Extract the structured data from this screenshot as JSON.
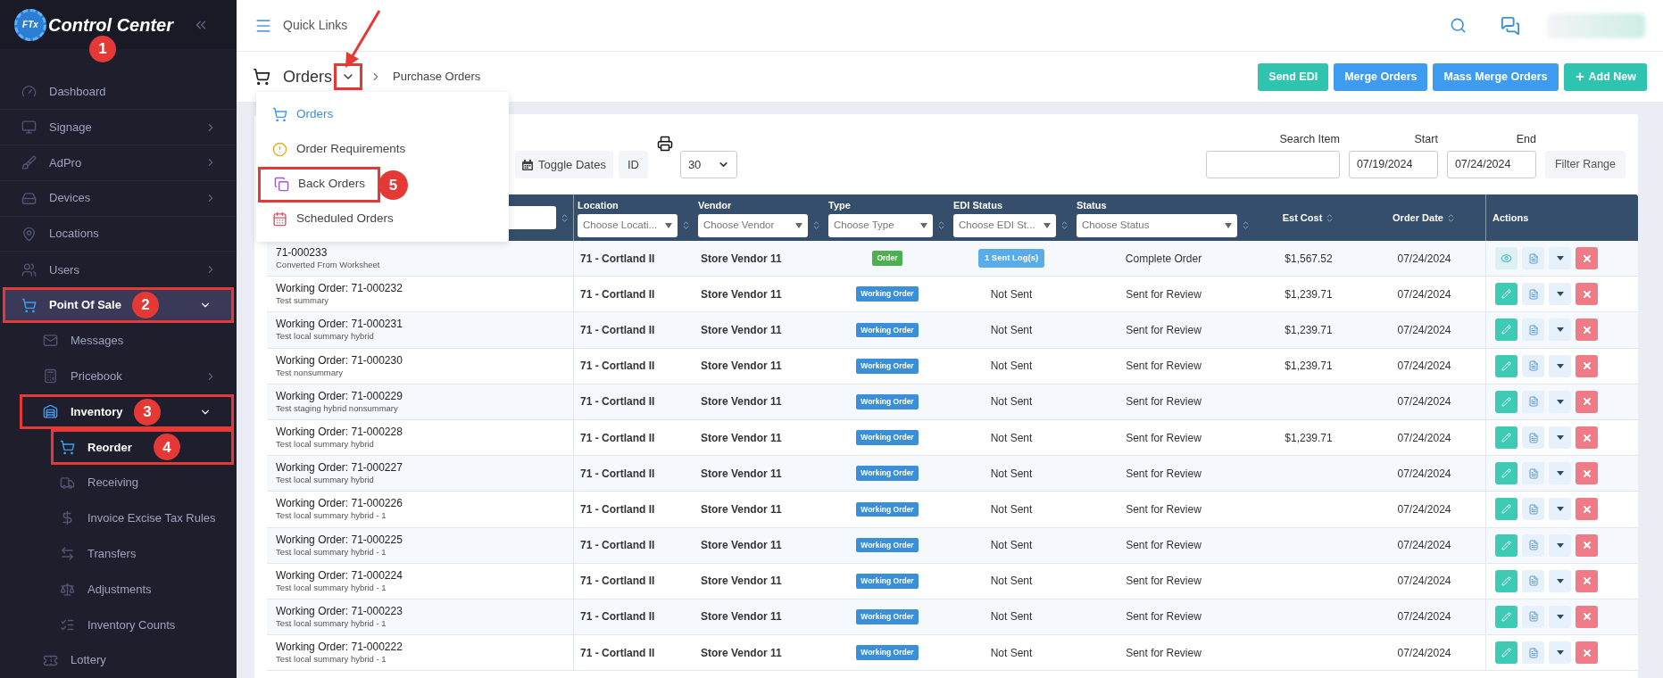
{
  "sidebar": {
    "logo": {
      "mark": "FTx",
      "title": "Control Center",
      "callout": "1"
    },
    "items": [
      {
        "label": "Dashboard",
        "selected": false
      },
      {
        "label": "Signage",
        "selected": false,
        "expanded": false
      },
      {
        "label": "AdPro",
        "selected": false,
        "expanded": false
      },
      {
        "label": "Devices",
        "selected": false,
        "expanded": false
      },
      {
        "label": "Locations",
        "selected": false
      },
      {
        "label": "Users",
        "selected": false,
        "expanded": false
      },
      {
        "label": "Point Of Sale",
        "selected": true,
        "expanded": true,
        "callout": "2",
        "children": [
          {
            "label": "Messages",
            "selected": false
          },
          {
            "label": "Pricebook",
            "selected": false,
            "expanded": false
          },
          {
            "label": "Inventory",
            "selected": true,
            "expanded": true,
            "callout": "3",
            "children": [
              {
                "label": "Reorder",
                "selected": true,
                "callout": "4"
              },
              {
                "label": "Receiving",
                "selected": false
              },
              {
                "label": "Invoice Excise Tax Rules",
                "selected": false
              },
              {
                "label": "Transfers",
                "selected": false
              },
              {
                "label": "Adjustments",
                "selected": false
              },
              {
                "label": "Inventory Counts",
                "selected": false
              }
            ]
          },
          {
            "label": "Lottery",
            "selected": false
          }
        ]
      }
    ]
  },
  "topbar": {
    "quick_links": "Quick Links"
  },
  "header": {
    "title": "Orders",
    "dropdown_annotated": true,
    "breadcrumb": "Purchase Orders",
    "buttons": [
      {
        "label": "Send EDI",
        "color": "#2ec4b0"
      },
      {
        "label": "Merge Orders",
        "color": "#3d9bf0"
      },
      {
        "label": "Mass Merge Orders",
        "color": "#3d9bf0"
      },
      {
        "label": "Add New",
        "color": "#2ec4b0",
        "kind": "add"
      }
    ]
  },
  "menu": {
    "items": [
      {
        "label": "Orders",
        "selected": true
      },
      {
        "label": "Order Requirements",
        "selected": false
      },
      {
        "label": "Back Orders",
        "selected": false,
        "callout": "5"
      },
      {
        "label": "Scheduled Orders",
        "selected": false
      }
    ]
  },
  "toolbar": {
    "toggle_dates": "Toggle Dates",
    "id": "ID",
    "page_size": "30",
    "search_item": {
      "label": "Search Item"
    },
    "start": {
      "label": "Start",
      "value": "07/19/2024"
    },
    "end": {
      "label": "End",
      "value": "07/24/2024"
    },
    "filter_button": "Filter Range"
  },
  "table": {
    "columns": [
      {
        "kind": "filter"
      },
      {
        "label": "Location",
        "kind": "filter",
        "placeholder": "Choose Locati..."
      },
      {
        "label": "Vendor",
        "kind": "filter",
        "placeholder": "Choose Vendor"
      },
      {
        "label": "Type",
        "kind": "filter",
        "placeholder": "Choose Type"
      },
      {
        "label": "EDI Status",
        "kind": "filter",
        "placeholder": "Choose EDI St..."
      },
      {
        "label": "Status",
        "kind": "filter",
        "placeholder": "Choose Status"
      },
      {
        "label": "Est Cost",
        "kind": "sort"
      },
      {
        "label": "Order Date",
        "kind": "sort"
      },
      {
        "label": "Actions",
        "kind": "plain"
      }
    ],
    "rows": [
      {
        "kind": "view",
        "title": "71-000233",
        "subtitle": "Converted From Worksheet",
        "location": "71 - Cortland II",
        "vendor": "Store Vendor 11",
        "type": {
          "label": "Order",
          "color": "#4caf50"
        },
        "edi_status": {
          "label": "1 Sent Log(s)",
          "kind": "badge"
        },
        "status": "Complete Order",
        "est_cost": "$1,567.52",
        "order_date": "07/24/2024"
      },
      {
        "kind": "edit",
        "title": "Working Order: 71-000232",
        "subtitle": "Test summary",
        "location": "71 - Cortland II",
        "vendor": "Store Vendor 11",
        "type": {
          "label": "Working Order",
          "color": "#3b8fd9"
        },
        "edi_status": {
          "label": "Not Sent",
          "kind": "text"
        },
        "status": "Sent for Review",
        "est_cost": "$1,239.71",
        "order_date": "07/24/2024"
      },
      {
        "kind": "edit",
        "title": "Working Order: 71-000231",
        "subtitle": "Test local summary hybrid",
        "location": "71 - Cortland II",
        "vendor": "Store Vendor 11",
        "type": {
          "label": "Working Order",
          "color": "#3b8fd9"
        },
        "edi_status": {
          "label": "Not Sent",
          "kind": "text"
        },
        "status": "Sent for Review",
        "est_cost": "$1,239.71",
        "order_date": "07/24/2024"
      },
      {
        "kind": "edit",
        "title": "Working Order: 71-000230",
        "subtitle": "Test nonsummary",
        "location": "71 - Cortland II",
        "vendor": "Store Vendor 11",
        "type": {
          "label": "Working Order",
          "color": "#3b8fd9"
        },
        "edi_status": {
          "label": "Not Sent",
          "kind": "text"
        },
        "status": "Sent for Review",
        "est_cost": "$1,239.71",
        "order_date": "07/24/2024"
      },
      {
        "kind": "edit",
        "title": "Working Order: 71-000229",
        "subtitle": "Test staging hybrid nonsummary",
        "location": "71 - Cortland II",
        "vendor": "Store Vendor 11",
        "type": {
          "label": "Working Order",
          "color": "#3b8fd9"
        },
        "edi_status": {
          "label": "Not Sent",
          "kind": "text"
        },
        "status": "Sent for Review",
        "order_date": "07/24/2024"
      },
      {
        "kind": "edit",
        "title": "Working Order: 71-000228",
        "subtitle": "Test local summary hybrid",
        "location": "71 - Cortland II",
        "vendor": "Store Vendor 11",
        "type": {
          "label": "Working Order",
          "color": "#3b8fd9"
        },
        "edi_status": {
          "label": "Not Sent",
          "kind": "text"
        },
        "status": "Sent for Review",
        "est_cost": "$1,239.71",
        "order_date": "07/24/2024"
      },
      {
        "kind": "edit",
        "title": "Working Order: 71-000227",
        "subtitle": "Test local summary hybrid",
        "location": "71 - Cortland II",
        "vendor": "Store Vendor 11",
        "type": {
          "label": "Working Order",
          "color": "#3b8fd9"
        },
        "edi_status": {
          "label": "Not Sent",
          "kind": "text"
        },
        "status": "Sent for Review",
        "order_date": "07/24/2024"
      },
      {
        "kind": "edit",
        "title": "Working Order: 71-000226",
        "subtitle": "Test local summary hybrid - 1",
        "location": "71 - Cortland II",
        "vendor": "Store Vendor 11",
        "type": {
          "label": "Working Order",
          "color": "#3b8fd9"
        },
        "edi_status": {
          "label": "Not Sent",
          "kind": "text"
        },
        "status": "Sent for Review",
        "order_date": "07/24/2024"
      },
      {
        "kind": "edit",
        "title": "Working Order: 71-000225",
        "subtitle": "Test local summary hybrid - 1",
        "location": "71 - Cortland II",
        "vendor": "Store Vendor 11",
        "type": {
          "label": "Working Order",
          "color": "#3b8fd9"
        },
        "edi_status": {
          "label": "Not Sent",
          "kind": "text"
        },
        "status": "Sent for Review",
        "order_date": "07/24/2024"
      },
      {
        "kind": "edit",
        "title": "Working Order: 71-000224",
        "subtitle": "Test local summary hybrid - 1",
        "location": "71 - Cortland II",
        "vendor": "Store Vendor 11",
        "type": {
          "label": "Working Order",
          "color": "#3b8fd9"
        },
        "edi_status": {
          "label": "Not Sent",
          "kind": "text"
        },
        "status": "Sent for Review",
        "order_date": "07/24/2024"
      },
      {
        "kind": "edit",
        "title": "Working Order: 71-000223",
        "subtitle": "Test local summary hybrid - 1",
        "location": "71 - Cortland II",
        "vendor": "Store Vendor 11",
        "type": {
          "label": "Working Order",
          "color": "#3b8fd9"
        },
        "edi_status": {
          "label": "Not Sent",
          "kind": "text"
        },
        "status": "Sent for Review",
        "order_date": "07/24/2024"
      },
      {
        "kind": "edit",
        "title": "Working Order: 71-000222",
        "subtitle": "Test local summary hybrid - 1",
        "location": "71 - Cortland II",
        "vendor": "Store Vendor 11",
        "type": {
          "label": "Working Order",
          "color": "#3b8fd9"
        },
        "edi_status": {
          "label": "Not Sent",
          "kind": "text"
        },
        "status": "Sent for Review",
        "order_date": "07/24/2024"
      }
    ]
  }
}
